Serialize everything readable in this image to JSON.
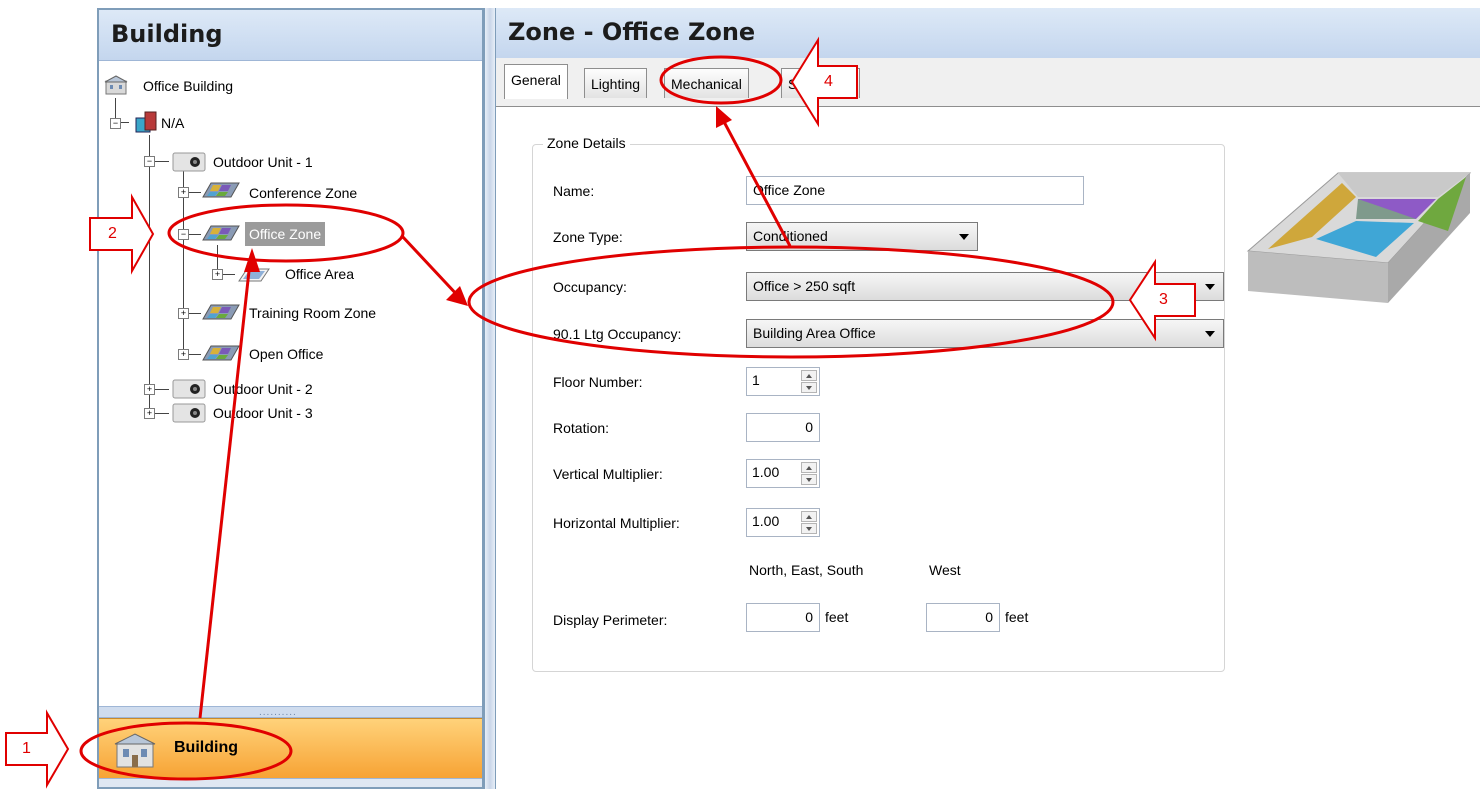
{
  "left_panel": {
    "title": "Building",
    "tree": [
      {
        "label": "Office Building"
      },
      {
        "label": "N/A"
      },
      {
        "label": "Outdoor Unit - 1"
      },
      {
        "label": "Conference Zone"
      },
      {
        "label": "Office Zone",
        "selected": true
      },
      {
        "label": "Office Area"
      },
      {
        "label": "Training Room Zone"
      },
      {
        "label": "Open Office"
      },
      {
        "label": "Outdoor Unit - 2"
      },
      {
        "label": "Outdoor Unit - 3"
      }
    ],
    "splitter_dots": "..........",
    "nav": {
      "building_label": "Building"
    }
  },
  "right_panel": {
    "title": "Zone - Office Zone",
    "tabs": [
      {
        "label": "General",
        "active": true
      },
      {
        "label": "Lighting"
      },
      {
        "label": "Mechanical"
      },
      {
        "label": "Schedules"
      }
    ],
    "zone_details": {
      "group_title": "Zone Details",
      "name_label": "Name:",
      "name_value": "Office Zone",
      "zone_type_label": "Zone Type:",
      "zone_type_value": "Conditioned",
      "occupancy_label": "Occupancy:",
      "occupancy_value": "Office > 250 sqft",
      "ltg_occupancy_label": "90.1 Ltg Occupancy:",
      "ltg_occupancy_value": "Building Area Office",
      "floor_number_label": "Floor Number:",
      "floor_number_value": "1",
      "rotation_label": "Rotation:",
      "rotation_value": "0",
      "vertical_multiplier_label": "Vertical Multiplier:",
      "vertical_multiplier_value": "1.00",
      "horizontal_multiplier_label": "Horizontal Multiplier:",
      "horizontal_multiplier_value": "1.00",
      "perimeter_header_nes": "North, East, South",
      "perimeter_header_west": "West",
      "display_perimeter_label": "Display Perimeter:",
      "perimeter_nes_value": "0",
      "perimeter_west_value": "0",
      "unit_feet": "feet"
    }
  },
  "annotations": {
    "callout_1": "1",
    "callout_2": "2",
    "callout_3": "3",
    "callout_4": "4",
    "color": "#e00000"
  },
  "colors": {
    "header_bg": "#c4d6ee",
    "nav_active": "#f7a233",
    "selected_tree_bg": "#9b9b9b"
  }
}
